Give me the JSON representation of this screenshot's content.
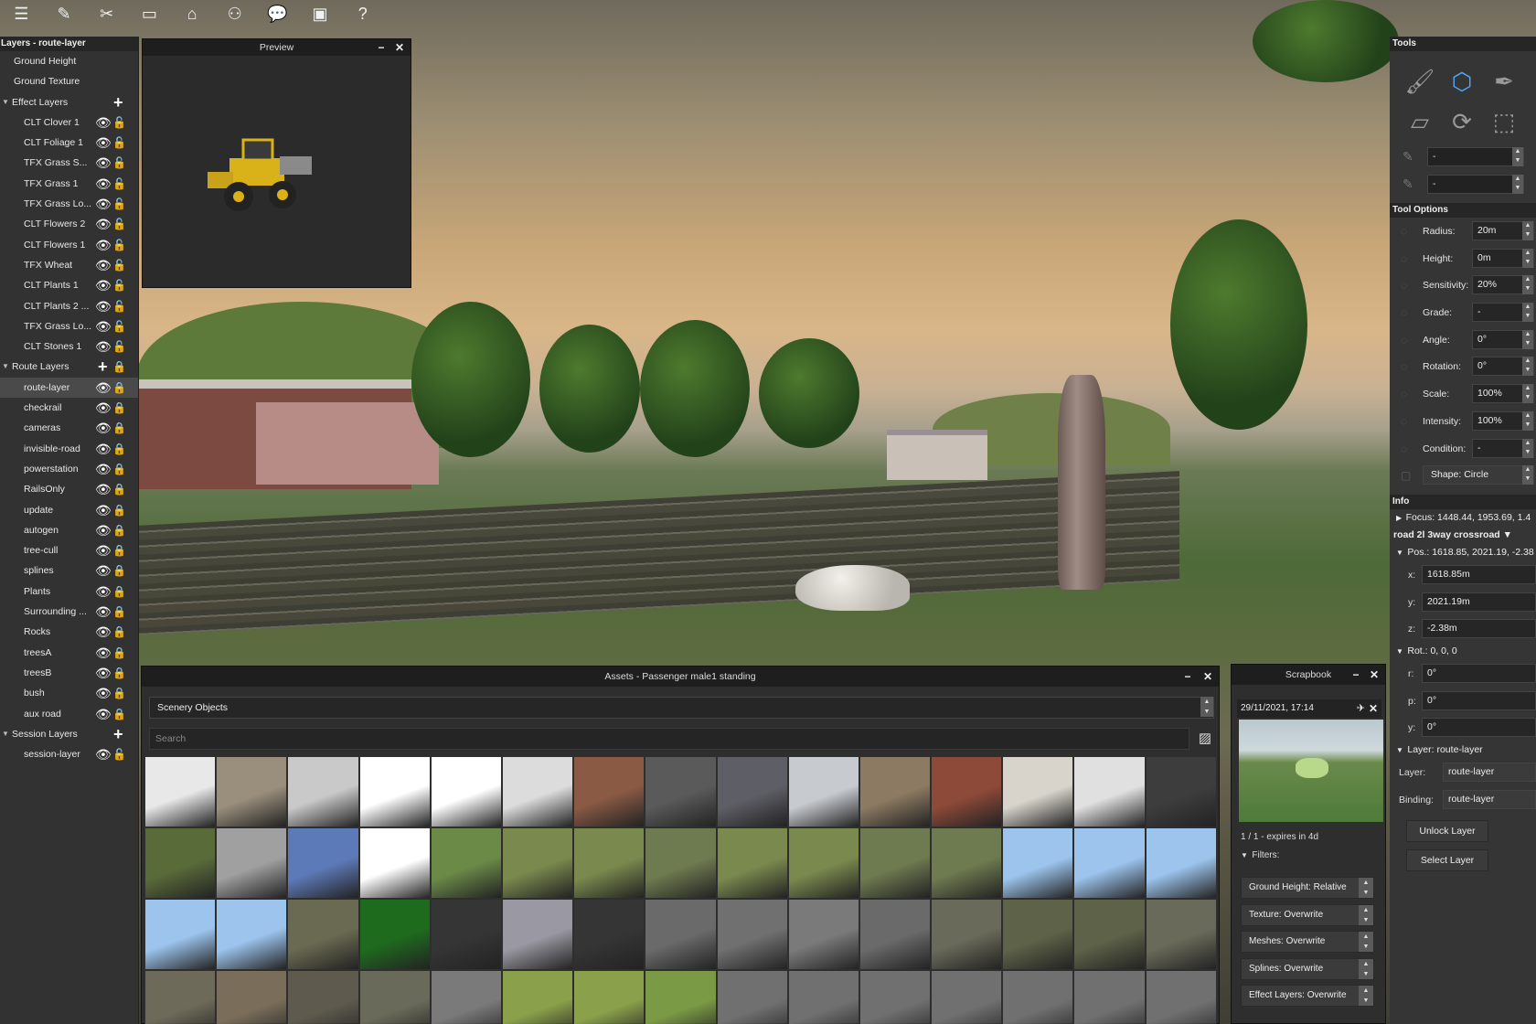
{
  "toolbar": {
    "icons": [
      "menu-icon",
      "edit-icon",
      "tools-icon",
      "monitor-icon",
      "camera-icon",
      "people-icon",
      "chat-icon",
      "window-icon",
      "help-icon"
    ],
    "glyphs": [
      "☰",
      "✎",
      "✂",
      "▭",
      "⌂",
      "⚇",
      "💬",
      "▣",
      "?"
    ]
  },
  "layers": {
    "title": "Layers - route-layer",
    "rows": [
      {
        "label": "Ground Height",
        "kind": "top"
      },
      {
        "label": "Ground Texture",
        "kind": "top"
      },
      {
        "label": "Effect Layers",
        "kind": "group",
        "plus": true
      },
      {
        "label": "CLT Clover 1",
        "kind": "item",
        "lock": "open"
      },
      {
        "label": "CLT Foliage 1",
        "kind": "item",
        "lock": "open"
      },
      {
        "label": "TFX Grass S...",
        "kind": "item",
        "lock": "open"
      },
      {
        "label": "TFX Grass 1",
        "kind": "item",
        "lock": "open"
      },
      {
        "label": "TFX Grass Lo...",
        "kind": "item",
        "lock": "open"
      },
      {
        "label": "CLT Flowers 2",
        "kind": "item",
        "lock": "open"
      },
      {
        "label": "CLT Flowers 1",
        "kind": "item",
        "lock": "open"
      },
      {
        "label": "TFX Wheat",
        "kind": "item",
        "lock": "open"
      },
      {
        "label": "CLT Plants 1",
        "kind": "item",
        "lock": "open"
      },
      {
        "label": "CLT Plants 2 ...",
        "kind": "item",
        "lock": "open"
      },
      {
        "label": "TFX Grass Lo...",
        "kind": "item",
        "lock": "open"
      },
      {
        "label": "CLT Stones 1",
        "kind": "item",
        "lock": "open"
      },
      {
        "label": "Route Layers",
        "kind": "group",
        "plus": true,
        "lockGroup": true
      },
      {
        "label": "route-layer",
        "kind": "item",
        "lock": "closed",
        "selected": true
      },
      {
        "label": "checkrail",
        "kind": "item",
        "lock": "closed"
      },
      {
        "label": "cameras",
        "kind": "item",
        "lock": "closed"
      },
      {
        "label": "invisible-road",
        "kind": "item",
        "lock": "closed"
      },
      {
        "label": "powerstation",
        "kind": "item",
        "lock": "closed"
      },
      {
        "label": "RailsOnly",
        "kind": "item",
        "lock": "closed"
      },
      {
        "label": "update",
        "kind": "item",
        "lock": "closed"
      },
      {
        "label": "autogen",
        "kind": "item",
        "lock": "closed"
      },
      {
        "label": "tree-cull",
        "kind": "item",
        "lock": "closed"
      },
      {
        "label": "splines",
        "kind": "item",
        "lock": "closed"
      },
      {
        "label": "Plants",
        "kind": "item",
        "lock": "closed"
      },
      {
        "label": "Surrounding ...",
        "kind": "item",
        "lock": "closed"
      },
      {
        "label": "Rocks",
        "kind": "item",
        "lock": "closed"
      },
      {
        "label": "treesA",
        "kind": "item",
        "lock": "closed"
      },
      {
        "label": "treesB",
        "kind": "item",
        "lock": "closed"
      },
      {
        "label": "bush",
        "kind": "item",
        "lock": "closed"
      },
      {
        "label": "aux road",
        "kind": "item",
        "lock": "closed"
      },
      {
        "label": "Session Layers",
        "kind": "group",
        "plus": true
      },
      {
        "label": "session-layer",
        "kind": "item",
        "lock": "open"
      }
    ]
  },
  "preview": {
    "title": "Preview",
    "minimize": "−",
    "close": "✕"
  },
  "tools": {
    "title": "Tools",
    "grid_icons": [
      "paint-brush-icon",
      "place-object-icon",
      "eyedropper-icon",
      "cube-icon",
      "rotate-object-icon",
      "marquee-select-icon"
    ],
    "grid_glyphs": [
      "🖌",
      "⬡",
      "✒",
      "▱",
      "⟳",
      "⬚"
    ],
    "selectors": [
      "-",
      "-"
    ],
    "options_title": "Tool Options",
    "options": [
      {
        "label": "Radius:",
        "value": "20m"
      },
      {
        "label": "Height:",
        "value": "0m"
      },
      {
        "label": "Sensitivity:",
        "value": "20%"
      },
      {
        "label": "Grade:",
        "value": "-"
      },
      {
        "label": "Angle:",
        "value": "0°"
      },
      {
        "label": "Rotation:",
        "value": "0°"
      },
      {
        "label": "Scale:",
        "value": "100%"
      },
      {
        "label": "Intensity:",
        "value": "100%"
      },
      {
        "label": "Condition:",
        "value": "-"
      }
    ],
    "shape": "Shape: Circle",
    "info_title": "Info",
    "focus": "Focus: 1448.44, 1953.69, 1.4",
    "object": "road 2l 3way crossroad ▼",
    "pos": "Pos.: 1618.85, 2021.19, -2.38",
    "x_label": "x:",
    "x_val": "1618.85m",
    "y_label": "y:",
    "y_val": "2021.19m",
    "z_label": "z:",
    "z_val": "-2.38m",
    "rot": "Rot.: 0, 0, 0",
    "r_label": "r:",
    "r_val": "0°",
    "p_label": "p:",
    "p_val": "0°",
    "yaw_label": "y:",
    "yaw_val": "0°",
    "layer_head": "Layer: route-layer",
    "layer_label": "Layer:",
    "layer_val": "route-layer",
    "binding_label": "Binding:",
    "binding_val": "route-layer",
    "unlock_btn": "Unlock Layer",
    "select_btn": "Select Layer"
  },
  "assets": {
    "title": "Assets - Passenger male1 standing",
    "category": "Scenery Objects",
    "search_placeholder": "Search",
    "minimize": "−",
    "close": "✕",
    "thumb_colors": [
      "#e8e8e8",
      "#9a8f7c",
      "#c9c9c9",
      "#ffffff",
      "#ffffff",
      "#dcdcdc",
      "#8a5a45",
      "#5a5a5a",
      "#5e5e66",
      "#c7cbd0",
      "#8d7a62",
      "#8e4a38",
      "#d8d4cc",
      "#e0e0e0",
      "#3d3d3d",
      "#5a6b3a",
      "#a0a0a0",
      "#5d7ab8",
      "#ffffff",
      "#6b8a48",
      "#7a8a4e",
      "#7a8a4e",
      "#6e7a50",
      "#7a8a4e",
      "#7a8a4e",
      "#6e7a50",
      "#6e7a50",
      "#9cc4ec",
      "#9cc4ec",
      "#9cc4ec",
      "#9cc4ec",
      "#9cc4ec",
      "#6a6a52",
      "#1e6b1e",
      "#353535",
      "#9a98a2",
      "#353535",
      "#6a6a6a",
      "#707070",
      "#7a7a7a",
      "#6a6a6a",
      "#6a6a5a",
      "#5e6248",
      "#5e6248",
      "#6a6a5a",
      "#6e6a5a",
      "#7a6e5a",
      "#5e5a4e",
      "#6a6a5a",
      "#7a7a7a",
      "#8aa04a",
      "#8aa04a",
      "#7a9a45",
      "#707070",
      "#707070",
      "#707070",
      "#707070",
      "#707070",
      "#707070",
      "#707070"
    ]
  },
  "scrapbook": {
    "title": "Scrapbook",
    "minimize": "−",
    "close": "✕",
    "entry_date": "29/11/2021, 17:14",
    "entry_pin": "✈",
    "entry_close": "✕",
    "count": "1 / 1  - expires in 4d",
    "filters_label": "Filters:",
    "filters": [
      "Ground Height: Relative",
      "Texture: Overwrite",
      "Meshes: Overwrite",
      "Splines: Overwrite",
      "Effect Layers: Overwrite"
    ]
  }
}
